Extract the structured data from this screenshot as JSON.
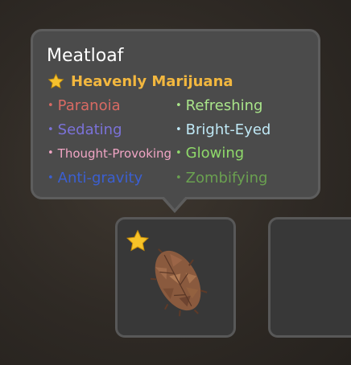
{
  "tooltip": {
    "item_name": "Meatloaf",
    "quality": {
      "label": "Heavenly Marijuana",
      "icon": "star-icon",
      "color": "#f2b73f"
    },
    "effects": [
      {
        "label": "Paranoia",
        "color": "#d96a63"
      },
      {
        "label": "Refreshing",
        "color": "#a9e58a"
      },
      {
        "label": "Sedating",
        "color": "#7b72d9"
      },
      {
        "label": "Bright-Eyed",
        "color": "#bfe8f5"
      },
      {
        "label": "Thought-Provoking",
        "color": "#f0a5c4"
      },
      {
        "label": "Glowing",
        "color": "#8fd96a"
      },
      {
        "label": "Anti-gravity",
        "color": "#3b5fd1"
      },
      {
        "label": "Zombifying",
        "color": "#6aa050"
      }
    ]
  },
  "inventory": {
    "slots": [
      {
        "item": "bud-icon",
        "quality_icon": "star-icon",
        "selected": true
      },
      {
        "item": null,
        "selected": false
      }
    ]
  }
}
